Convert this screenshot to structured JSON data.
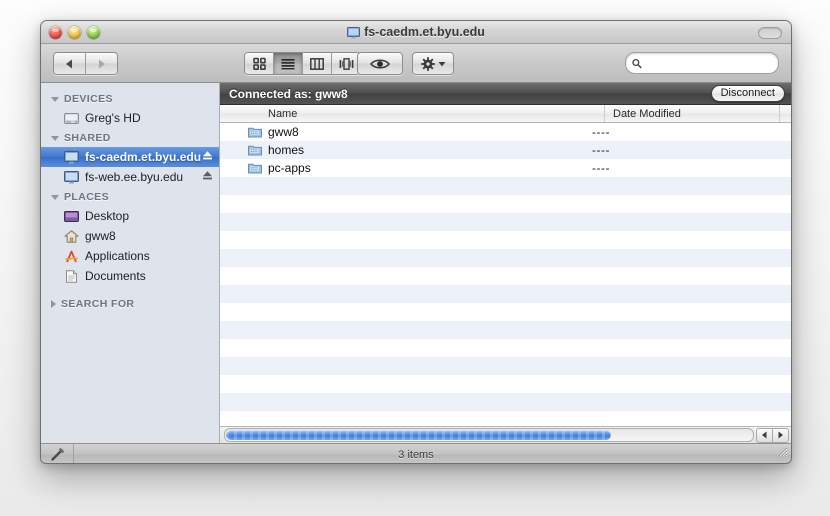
{
  "window": {
    "title": "fs-caedm.et.byu.edu",
    "title_icon": "display-icon",
    "lights": {
      "close": "close-button",
      "minimize": "minimize-button",
      "zoom": "zoom-button"
    }
  },
  "toolbar": {
    "back_label": "back-arrow",
    "forward_label": "forward-arrow",
    "views": [
      {
        "name": "icon-view",
        "icon": "grid-icon",
        "active": false
      },
      {
        "name": "list-view",
        "icon": "list-icon",
        "active": true
      },
      {
        "name": "column-view",
        "icon": "columns-icon",
        "active": false
      },
      {
        "name": "coverflow-view",
        "icon": "coverflow-icon",
        "active": false
      }
    ],
    "quicklook": "eye-icon",
    "action": "gear-icon",
    "search_placeholder": "",
    "search_value": ""
  },
  "sidebar": {
    "sections": [
      {
        "label": "DEVICES",
        "expanded": true,
        "items": [
          {
            "label": "Greg's HD",
            "icon": "harddisk-icon",
            "selected": false,
            "eject": false
          }
        ]
      },
      {
        "label": "SHARED",
        "expanded": true,
        "items": [
          {
            "label": "fs-caedm.et.byu.edu",
            "icon": "display-icon",
            "selected": true,
            "eject": true
          },
          {
            "label": "fs-web.ee.byu.edu",
            "icon": "display-icon",
            "selected": false,
            "eject": true
          }
        ]
      },
      {
        "label": "PLACES",
        "expanded": true,
        "items": [
          {
            "label": "Desktop",
            "icon": "desktop-icon",
            "selected": false,
            "eject": false
          },
          {
            "label": "gww8",
            "icon": "home-icon",
            "selected": false,
            "eject": false
          },
          {
            "label": "Applications",
            "icon": "applications-icon",
            "selected": false,
            "eject": false
          },
          {
            "label": "Documents",
            "icon": "documents-icon",
            "selected": false,
            "eject": false
          }
        ]
      },
      {
        "label": "SEARCH FOR",
        "expanded": false,
        "items": []
      }
    ]
  },
  "main": {
    "connected_label": "Connected as: gww8",
    "disconnect_label": "Disconnect",
    "columns": [
      "Name",
      "Date Modified"
    ],
    "rows": [
      {
        "name": "gww8",
        "date": "----",
        "icon": "shared-folder-icon"
      },
      {
        "name": "homes",
        "date": "----",
        "icon": "shared-folder-icon"
      },
      {
        "name": "pc-apps",
        "date": "----",
        "icon": "shared-folder-icon"
      }
    ]
  },
  "status": {
    "items_label": "3 items",
    "edit_icon": "pencil-icon"
  },
  "colors": {
    "selection_blue": "#3f78cf",
    "sidebar_bg": "#dfe4ec",
    "row_alt": "#edf1f9",
    "scrollbar_blue": "#5b93e8"
  }
}
